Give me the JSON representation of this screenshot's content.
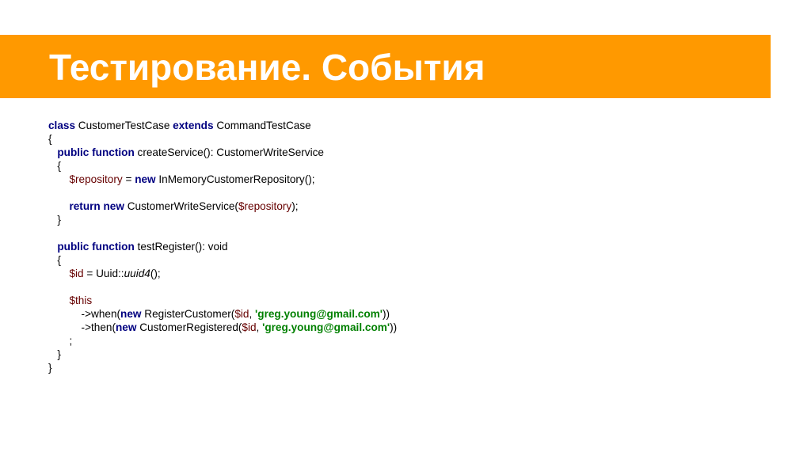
{
  "title": "Тестирование. События",
  "colors": {
    "title_bar": "#ff9900",
    "title_text": "#ffffff",
    "keyword": "#000080",
    "variable": "#660000",
    "string": "#008000"
  },
  "code": {
    "l1": {
      "kw_class": "class",
      "t1": " CustomerTestCase ",
      "kw_extends": "extends",
      "t2": " CommandTestCase"
    },
    "l2": {
      "t": "{"
    },
    "l3": {
      "kw_public": "public",
      "kw_function": "function",
      "t": " createService(): CustomerWriteService"
    },
    "l4": {
      "t": "{"
    },
    "l5": {
      "var": "$repository",
      "t1": " = ",
      "kw_new": "new",
      "t2": " InMemoryCustomerRepository();"
    },
    "l6": {
      "t": ""
    },
    "l7": {
      "kw_return": "return",
      "kw_new": "new",
      "t1": " CustomerWriteService(",
      "var": "$repository",
      "t2": ");"
    },
    "l8": {
      "t": "}"
    },
    "l9": {
      "t": ""
    },
    "l10": {
      "kw_public": "public",
      "kw_function": "function",
      "t": " testRegister(): void"
    },
    "l11": {
      "t": "{"
    },
    "l12": {
      "var": "$id",
      "t1": " = Uuid::",
      "italic": "uuid4",
      "t2": "();"
    },
    "l13": {
      "t": ""
    },
    "l14": {
      "var": "$this"
    },
    "l15": {
      "t1": "->when(",
      "kw_new": "new",
      "t2": " RegisterCustomer(",
      "var": "$id",
      "t3": ", ",
      "str": "'greg.young@gmail.com'",
      "t4": "))"
    },
    "l16": {
      "t1": "->then(",
      "kw_new": "new",
      "t2": " CustomerRegistered(",
      "var": "$id",
      "t3": ", ",
      "str": "'greg.young@gmail.com'",
      "t4": "))"
    },
    "l17": {
      "t": ";"
    },
    "l18": {
      "t": "}"
    },
    "l19": {
      "t": "}"
    }
  }
}
